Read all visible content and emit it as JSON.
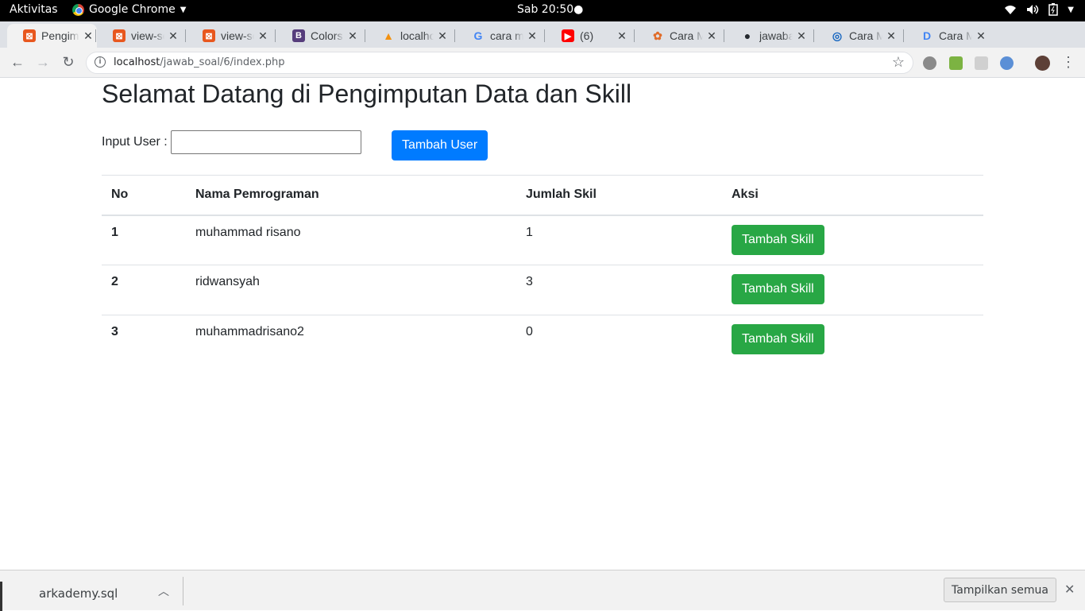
{
  "system": {
    "activities": "Aktivitas",
    "app_name": "Google Chrome",
    "clock": "Sab 20:50"
  },
  "tabs": [
    {
      "title": "Pengimputan Data dan Skill",
      "favicon": "xampp-icon",
      "color": "#e8571e",
      "active": true
    },
    {
      "title": "view-source",
      "favicon": "xampp-icon",
      "color": "#e8571e",
      "active": false
    },
    {
      "title": "view-source",
      "favicon": "xampp-icon",
      "color": "#e8571e",
      "active": false
    },
    {
      "title": "Colors",
      "favicon": "bootstrap-icon",
      "color": "#563d7c",
      "active": false
    },
    {
      "title": "localhost",
      "favicon": "phpmyadmin-icon",
      "color": "#f29111",
      "active": false
    },
    {
      "title": "cara membuat",
      "favicon": "google-icon",
      "color": "#4285f4",
      "active": false
    },
    {
      "title": "(6) ",
      "favicon": "youtube-icon",
      "color": "#ff0000",
      "active": false
    },
    {
      "title": "Cara Membuat",
      "favicon": "gear-orange-icon",
      "color": "#e06c2a",
      "active": false
    },
    {
      "title": "jawaban",
      "favicon": "github-icon",
      "color": "#24292e",
      "active": false
    },
    {
      "title": "Cara Mudah",
      "favicon": "blue-circle-icon",
      "color": "#1565c0",
      "active": false
    },
    {
      "title": "Cara Membuat",
      "favicon": "docs-d-icon",
      "color": "#4285f4",
      "active": false
    }
  ],
  "toolbar": {
    "url_host": "localhost",
    "url_path": "/jawab_soal/6/index.php"
  },
  "page": {
    "title": "Selamat Datang di Pengimputan Data dan Skill",
    "input_label": "Input User :",
    "input_value": "",
    "add_user_label": "Tambah User",
    "table": {
      "headers": [
        "No",
        "Nama Pemrograman",
        "Jumlah Skil",
        "Aksi"
      ],
      "rows": [
        {
          "no": "1",
          "name": "muhammad risano",
          "count": "1",
          "action": "Tambah Skill"
        },
        {
          "no": "2",
          "name": "ridwansyah",
          "count": "3",
          "action": "Tambah Skill"
        },
        {
          "no": "3",
          "name": "muhammadrisano2",
          "count": "0",
          "action": "Tambah Skill"
        }
      ]
    }
  },
  "downloads": {
    "file": "arkademy.sql",
    "show_all": "Tampilkan semua"
  },
  "colors": {
    "primary": "#007bff",
    "success": "#28a745"
  }
}
